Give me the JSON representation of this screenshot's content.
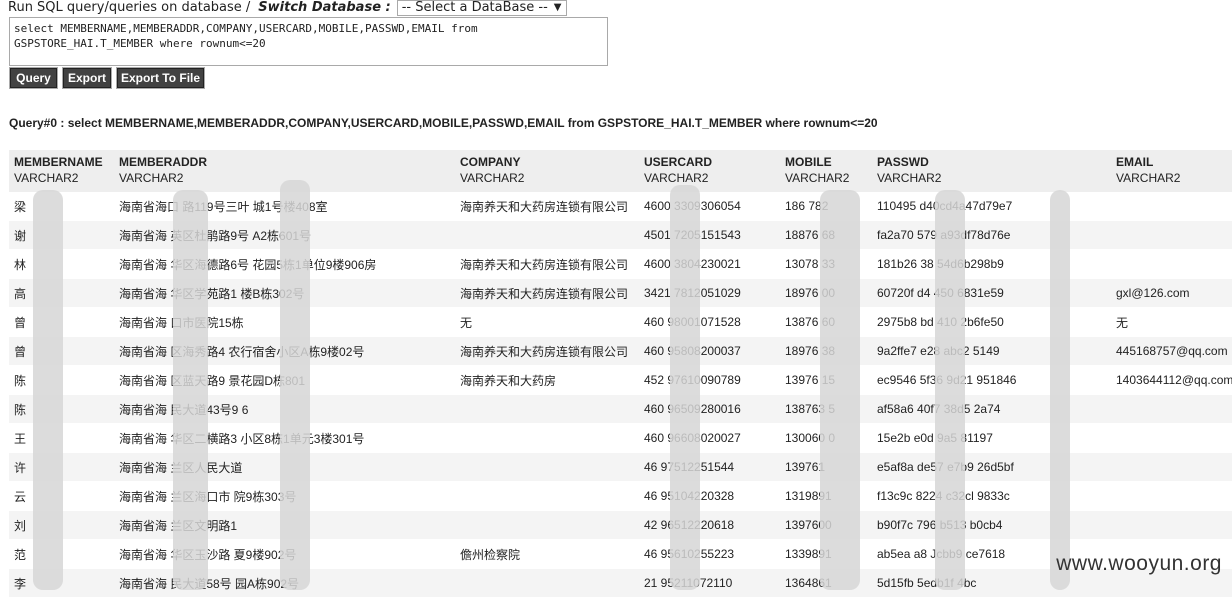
{
  "header": {
    "run_label": "Run SQL query/queries on database /",
    "switch_label": "Switch Database :",
    "db_select_value": "-- Select a DataBase --"
  },
  "sql": "select MEMBERNAME,MEMBERADDR,COMPANY,USERCARD,MOBILE,PASSWD,EMAIL from GSPSTORE_HAI.T_MEMBER where rownum<=20",
  "buttons": {
    "query": "Query",
    "export": "Export",
    "export_file": "Export To File"
  },
  "query_title": "Query#0 : select MEMBERNAME,MEMBERADDR,COMPANY,USERCARD,MOBILE,PASSWD,EMAIL from GSPSTORE_HAI.T_MEMBER where rownum<=20",
  "columns": [
    {
      "name": "MEMBERNAME",
      "type": "VARCHAR2"
    },
    {
      "name": "MEMBERADDR",
      "type": "VARCHAR2"
    },
    {
      "name": "COMPANY",
      "type": "VARCHAR2"
    },
    {
      "name": "USERCARD",
      "type": "VARCHAR2"
    },
    {
      "name": "MOBILE",
      "type": "VARCHAR2"
    },
    {
      "name": "PASSWD",
      "type": "VARCHAR2"
    },
    {
      "name": "EMAIL",
      "type": "VARCHAR2"
    }
  ],
  "rows": [
    [
      "梁",
      "海南省海口  路119号三叶  城1号楼408室",
      "海南养天和大药房连锁有限公司",
      "4600  3309306054",
      "186  782",
      "110495  d40cd4a47d79e7",
      ""
    ],
    [
      "谢",
      "海南省海  英区杜鹃路9号  A2栋601号",
      "",
      "4501  7205151543",
      "18876  68",
      "fa2a70  579  a93df78d76e",
      ""
    ],
    [
      "林",
      "海南省海  华区海德路6号  花园5栋1单位9楼906房",
      "海南养天和大药房连锁有限公司",
      "4600  3804230021",
      "13078  33",
      "181b26  38  54d6b298b9",
      ""
    ],
    [
      "高",
      "海南省海  华区学苑路1  楼B栋302号",
      "海南养天和大药房连锁有限公司",
      "3421  7812051029",
      "18976  00",
      "60720f  d4  450  6831e59",
      "gxl@126.com"
    ],
    [
      "曾",
      "海南省海  口市医院15栋",
      "无",
      "460  98001071528",
      "13876  60",
      "2975b8  bd  410  2b6fe50",
      "无"
    ],
    [
      "曾",
      "海南省海  区海秀路4  农行宿舍小区A栋9楼02号",
      "海南养天和大药房连锁有限公司",
      "460  95808200037",
      "18976  38",
      "9a2ffe7  e28  abc2  5149",
      "445168757@qq.com"
    ],
    [
      "陈",
      "海南省海  区蓝天路9  景花园D栋801",
      "海南养天和大药房",
      "452  97610090789",
      "13976  15",
      "ec9546  5f36  9d21  951846",
      "1403644112@qq.com"
    ],
    [
      "陈",
      "海南省海  民大道43号9  6",
      "",
      "460  96509280016",
      "138763  5",
      "af58a6  40f7  38d5  2a74",
      ""
    ],
    [
      "王",
      "海南省海  华区二横路3  小区8栋1单元3楼301号",
      "",
      "460  96608020027",
      "130060  0",
      "15e2b  e0d  9a5  81197",
      ""
    ],
    [
      "许",
      "海南省海  兰区人民大道",
      "",
      "46  97512251544",
      "139761  ",
      "e5af8a  de57  e7b9  26d5bf",
      ""
    ],
    [
      "云",
      "海南省海  兰区海口市  院9栋303号",
      "",
      "46  95104220328",
      "1319891",
      "f13c9c  8224  c32cl  9833c",
      ""
    ],
    [
      "刘",
      "海南省海  兰区文明路1",
      "",
      "42  96512220618",
      "1397600",
      "b90f7c  796  b513  b0cb4",
      ""
    ],
    [
      "范",
      "海南省海  华区玉沙路  夏9楼902号",
      "儋州检察院",
      "46  95610255223",
      "1339891",
      "ab5ea  a8  Jcbb9  ce7618",
      ""
    ],
    [
      "李",
      "海南省海  民大道58号  园A栋902号",
      "",
      "21  95211072110",
      "1364861",
      "5d15fb  5edb1f  4bc",
      ""
    ]
  ],
  "watermark": "www.wooyun.org"
}
